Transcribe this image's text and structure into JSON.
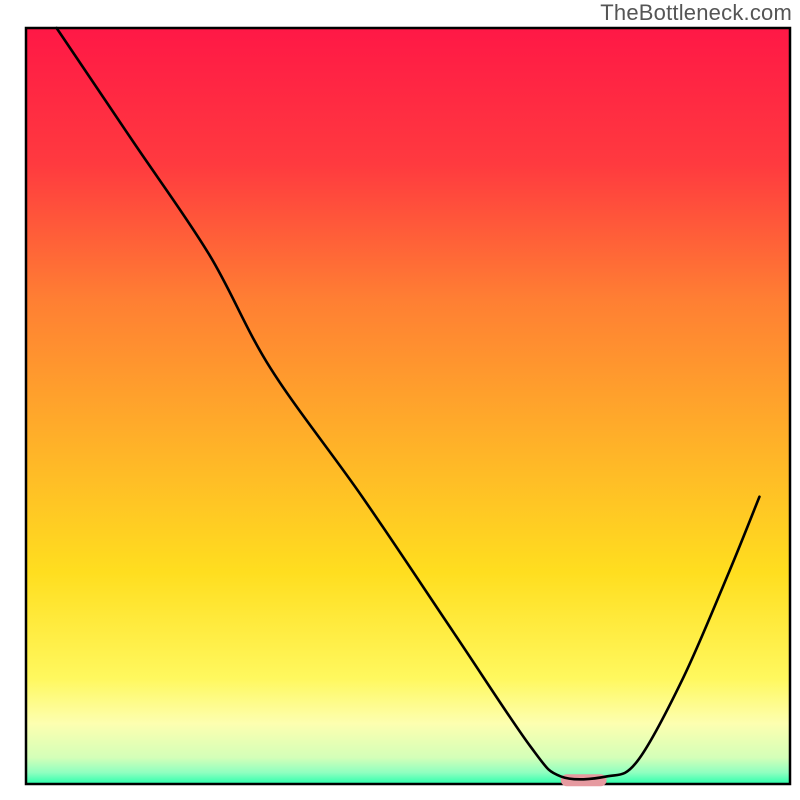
{
  "watermark": "TheBottleneck.com",
  "chart_data": {
    "type": "line",
    "title": "",
    "xlabel": "",
    "ylabel": "",
    "xlim": [
      0,
      100
    ],
    "ylim": [
      0,
      100
    ],
    "grid": false,
    "background_gradient": {
      "stops": [
        {
          "offset": 0.0,
          "color": "#ff1846"
        },
        {
          "offset": 0.18,
          "color": "#ff3a3f"
        },
        {
          "offset": 0.36,
          "color": "#ff7f33"
        },
        {
          "offset": 0.56,
          "color": "#ffb428"
        },
        {
          "offset": 0.72,
          "color": "#ffde1f"
        },
        {
          "offset": 0.86,
          "color": "#fff85e"
        },
        {
          "offset": 0.92,
          "color": "#fdffb0"
        },
        {
          "offset": 0.965,
          "color": "#d4ffb8"
        },
        {
          "offset": 0.985,
          "color": "#8fffc0"
        },
        {
          "offset": 1.0,
          "color": "#2bffad"
        }
      ]
    },
    "axes_stroke": "#000000",
    "series": [
      {
        "name": "bottleneck-curve",
        "stroke": "#000000",
        "x": [
          4.0,
          14.0,
          24.0,
          32.0,
          44.0,
          56.0,
          66.0,
          70.0,
          76.0,
          80.0,
          86.0,
          92.0,
          96.0
        ],
        "values": [
          100.0,
          85.0,
          70.0,
          55.0,
          38.0,
          20.0,
          5.0,
          1.0,
          1.0,
          3.0,
          14.0,
          28.0,
          38.0
        ]
      }
    ],
    "highlight_marker": {
      "name": "optimal-zone",
      "shape": "pill",
      "color": "#e69aa0",
      "x_start": 70.0,
      "x_end": 76.0,
      "y": 0.5
    }
  }
}
